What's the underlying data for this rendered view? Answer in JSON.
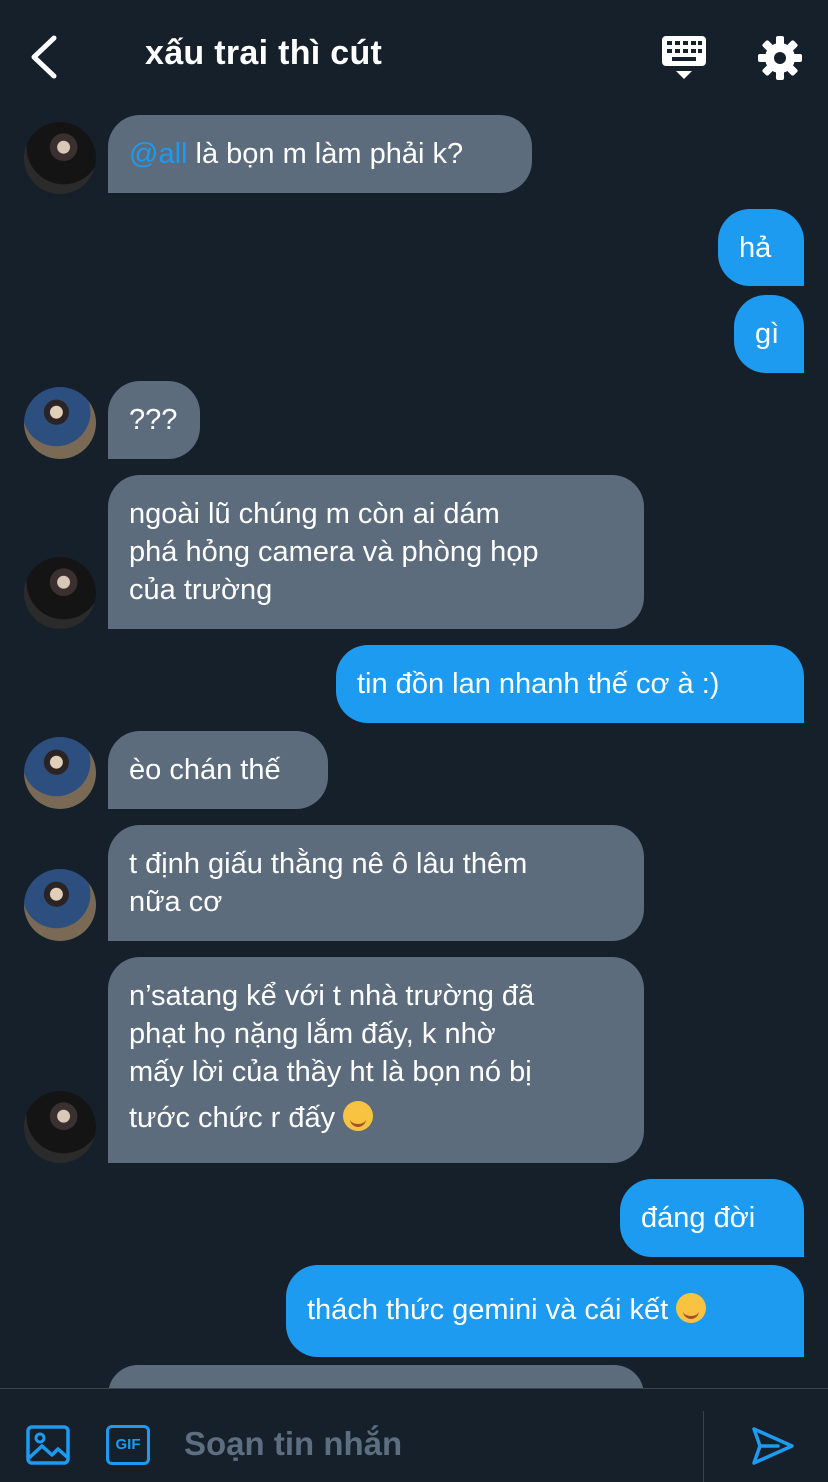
{
  "header": {
    "title": "xấu trai thì cút"
  },
  "messages": [
    {
      "mention": "@all",
      "text": " là bọn m làm phải k?"
    },
    {
      "text": "hả"
    },
    {
      "text": "gì"
    },
    {
      "text": "???"
    },
    {
      "line1": "ngoài lũ chúng m còn ai dám",
      "line2": "phá hỏng camera và phòng họp",
      "line3": "của trường"
    },
    {
      "text": "tin đồn lan nhanh thế cơ à :)"
    },
    {
      "text": "èo chán thế"
    },
    {
      "line1": "t định giấu thằng nê ô lâu thêm",
      "line2": "nữa cơ"
    },
    {
      "line1": "n’satang kể với t nhà trường đã",
      "line2": "phạt họ nặng lắm đấy, k nhờ",
      "line3": "mấy lời của thầy ht là bọn nó bị",
      "line4": "tước chức r đấy",
      "emoji": "smiling-face-with-hearts"
    },
    {
      "text": "đáng đời"
    },
    {
      "text": "thách thức gemini và cái kết",
      "emoji": "winking-face"
    }
  ],
  "composer": {
    "placeholder": "Soạn tin nhắn",
    "gif_label": "GIF"
  },
  "colors": {
    "background": "#15202b",
    "incoming": "#5c6c7d",
    "outgoing": "#1d9bf0",
    "accent": "#1d9bf0"
  }
}
